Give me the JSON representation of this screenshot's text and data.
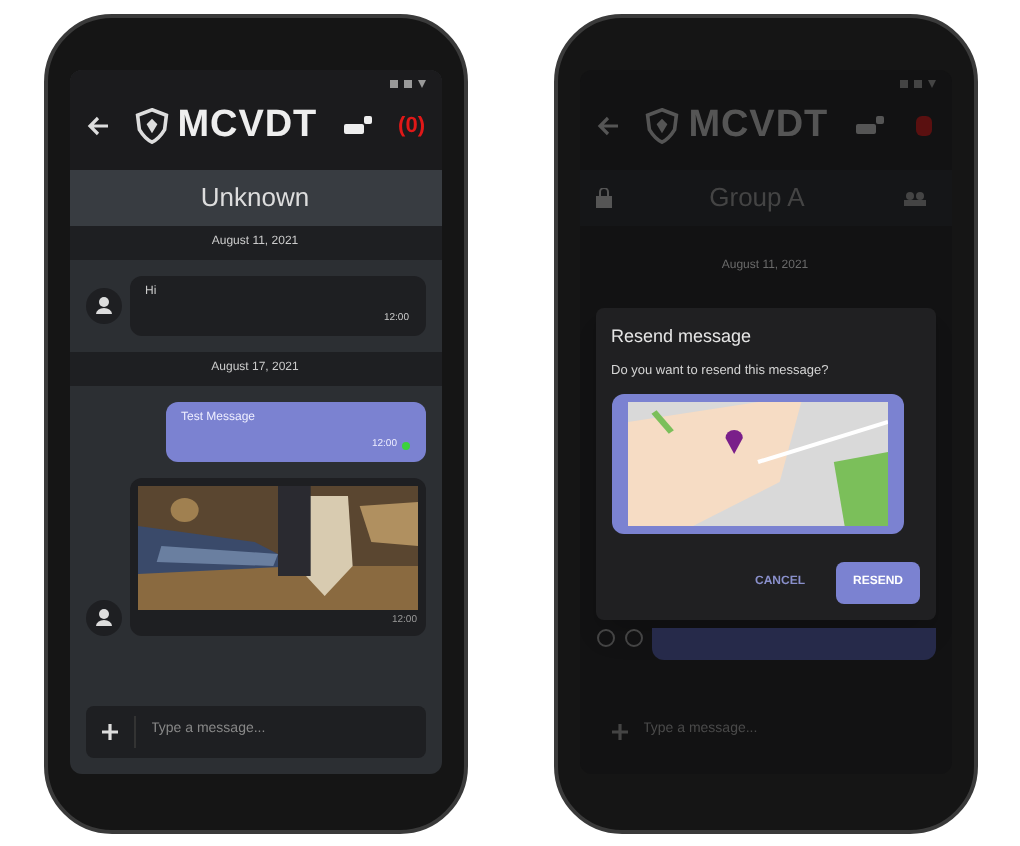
{
  "chat_screen": {
    "header": {
      "brand": "MCVDT",
      "alert_count": "(0)"
    },
    "title": "Unknown",
    "timeline": [
      {
        "kind": "date",
        "text": "August 11, 2021"
      },
      {
        "kind": "received",
        "text": "Hi",
        "time": "12:00"
      },
      {
        "kind": "date",
        "text": "August 17, 2021"
      },
      {
        "kind": "sent",
        "text": "Test Message",
        "time": "12:00",
        "delivered": true
      },
      {
        "time": "12:00"
      }
    ],
    "composer": {
      "placeholder": "Type a message..."
    }
  },
  "resend_screen": {
    "header": {
      "brand": "MCVDT"
    },
    "title": "Group A",
    "date": "August 11, 2021",
    "dialog": {
      "title": "Resend message",
      "text": "Do you want to resend this message?",
      "buttons": [
        {
          "label": "CANCEL",
          "primary": false
        },
        {
          "label": "RESEND",
          "primary": true
        }
      ]
    },
    "composer": {
      "placeholder": "Type a message..."
    }
  }
}
